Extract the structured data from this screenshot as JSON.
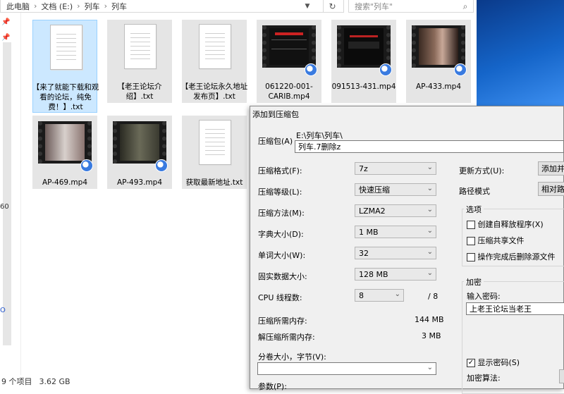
{
  "explorer": {
    "breadcrumb": [
      "此电脑",
      "文档 (E:)",
      "列车",
      "列车"
    ],
    "search_placeholder": "搜索\"列车\"",
    "status_count": "9 个项目",
    "status_size": "3.62 GB",
    "left_num": "60",
    "left_letter": "O",
    "files": [
      {
        "name": "【来了就能下载和观看的论坛，纯免费！】.txt",
        "type": "txt"
      },
      {
        "name": "【老王论坛介绍】.txt",
        "type": "txt"
      },
      {
        "name": "【老王论坛永久地址发布页】.txt",
        "type": "txt"
      },
      {
        "name": "061220-001-CARIB.mp4",
        "type": "video"
      },
      {
        "name": "091513-431.mp4",
        "type": "video"
      },
      {
        "name": "AP-433.mp4",
        "type": "video"
      },
      {
        "name": "AP-469.mp4",
        "type": "video"
      },
      {
        "name": "AP-493.mp4",
        "type": "video"
      },
      {
        "name": "获取最新地址.txt",
        "type": "txt"
      }
    ]
  },
  "dialog": {
    "title": "添加到压缩包",
    "archive_label": "压缩包(A)",
    "archive_path": "E:\\列车\\列车\\",
    "archive_name": "列车.7删除z",
    "format_label": "压缩格式(F):",
    "format_value": "7z",
    "level_label": "压缩等级(L):",
    "level_value": "快速压缩",
    "method_label": "压缩方法(M):",
    "method_value": "LZMA2",
    "dict_label": "字典大小(D):",
    "dict_value": "1 MB",
    "word_label": "单词大小(W):",
    "word_value": "32",
    "solid_label": "固实数据大小:",
    "solid_value": "128 MB",
    "cpu_label": "CPU 线程数:",
    "cpu_value": "8",
    "cpu_total": "/ 8",
    "mem_comp_label": "压缩所需内存:",
    "mem_comp_value": "144 MB",
    "mem_decomp_label": "解压缩所需内存:",
    "mem_decomp_value": "3 MB",
    "split_label": "分卷大小，字节(V):",
    "params_label": "参数(P):",
    "update_label": "更新方式(U):",
    "update_value": "添加并替",
    "path_label": "路径模式",
    "path_value": "相对路径",
    "options_title": "选项",
    "opt_sfx": "创建自释放程序(X)",
    "opt_shared": "压缩共享文件",
    "opt_delete": "操作完成后删除源文件",
    "encrypt_title": "加密",
    "pwd_label": "输入密码:",
    "pwd_value": "上老王论坛当老王",
    "show_pwd": "显示密码(S)",
    "show_pwd_checked": "✓",
    "enc_method_label": "加密算法:"
  }
}
